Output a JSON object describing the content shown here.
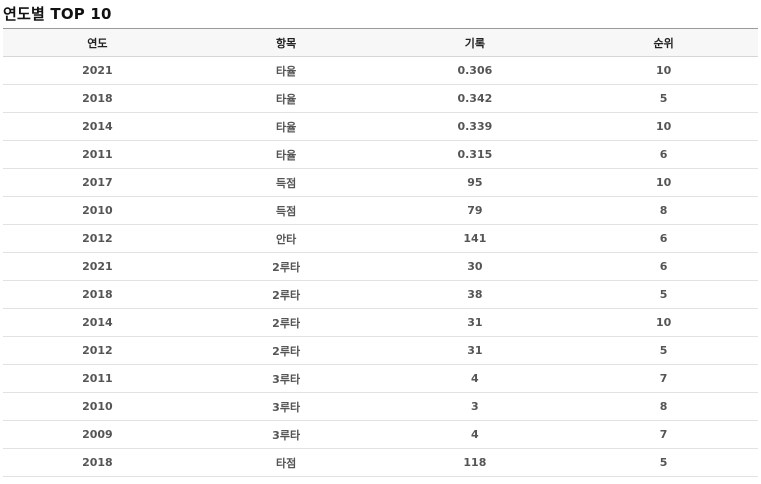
{
  "section": {
    "title": "연도별 TOP 10"
  },
  "table": {
    "columns": [
      "연도",
      "항목",
      "기록",
      "순위"
    ],
    "rows": [
      {
        "year": "2021",
        "item": "타율",
        "value": "0.306",
        "rank": "10"
      },
      {
        "year": "2018",
        "item": "타율",
        "value": "0.342",
        "rank": "5"
      },
      {
        "year": "2014",
        "item": "타율",
        "value": "0.339",
        "rank": "10"
      },
      {
        "year": "2011",
        "item": "타율",
        "value": "0.315",
        "rank": "6"
      },
      {
        "year": "2017",
        "item": "득점",
        "value": "95",
        "rank": "10"
      },
      {
        "year": "2010",
        "item": "득점",
        "value": "79",
        "rank": "8"
      },
      {
        "year": "2012",
        "item": "안타",
        "value": "141",
        "rank": "6"
      },
      {
        "year": "2021",
        "item": "2루타",
        "value": "30",
        "rank": "6"
      },
      {
        "year": "2018",
        "item": "2루타",
        "value": "38",
        "rank": "5"
      },
      {
        "year": "2014",
        "item": "2루타",
        "value": "31",
        "rank": "10"
      },
      {
        "year": "2012",
        "item": "2루타",
        "value": "31",
        "rank": "5"
      },
      {
        "year": "2011",
        "item": "3루타",
        "value": "4",
        "rank": "7"
      },
      {
        "year": "2010",
        "item": "3루타",
        "value": "3",
        "rank": "8"
      },
      {
        "year": "2009",
        "item": "3루타",
        "value": "4",
        "rank": "7"
      },
      {
        "year": "2018",
        "item": "타점",
        "value": "118",
        "rank": "5"
      }
    ]
  }
}
